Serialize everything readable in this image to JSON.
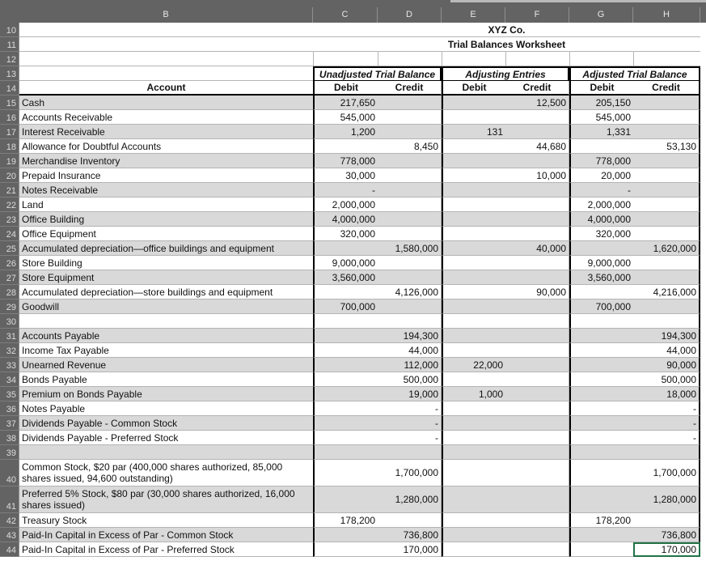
{
  "app": {
    "type": "spreadsheet",
    "accent_selection_color": "#217346",
    "header_band_color": "#636363",
    "shaded_row_color": "#d9d9d9"
  },
  "column_headers": [
    "B",
    "C",
    "D",
    "E",
    "F",
    "G",
    "H"
  ],
  "titles": {
    "company": "XYZ Co.",
    "worksheet": "Trial Balances Worksheet"
  },
  "group_headers": [
    {
      "label": "Unadjusted Trial Balance",
      "span": [
        "C",
        "D"
      ]
    },
    {
      "label": "Adjusting Entries",
      "span": [
        "E",
        "F"
      ]
    },
    {
      "label": "Adjusted Trial Balance",
      "span": [
        "G",
        "H"
      ]
    }
  ],
  "sub_headers": {
    "account": "Account",
    "unadjusted_debit": "Debit",
    "unadjusted_credit": "Credit",
    "adjusting_debit": "Debit",
    "adjusting_credit": "Credit",
    "adjusted_debit": "Debit",
    "adjusted_credit": "Credit"
  },
  "rows": [
    {
      "n": "10",
      "kind": "title",
      "text": "XYZ Co."
    },
    {
      "n": "11",
      "kind": "title",
      "text": "Trial Balances Worksheet"
    },
    {
      "n": "12",
      "kind": "blank"
    },
    {
      "n": "13",
      "kind": "group"
    },
    {
      "n": "14",
      "kind": "sub"
    },
    {
      "n": "15",
      "account": "Cash",
      "ud": "217,650",
      "uc": "",
      "ad": "",
      "ac": "12,500",
      "jd": "205,150",
      "jc": ""
    },
    {
      "n": "16",
      "account": "Accounts Receivable",
      "ud": "545,000",
      "uc": "",
      "ad": "",
      "ac": "",
      "jd": "545,000",
      "jc": ""
    },
    {
      "n": "17",
      "account": "Interest Receivable",
      "ud": "1,200",
      "uc": "",
      "ad": "131",
      "ac": "",
      "jd": "1,331",
      "jc": ""
    },
    {
      "n": "18",
      "account": "Allowance for Doubtful Accounts",
      "ud": "",
      "uc": "8,450",
      "ad": "",
      "ac": "44,680",
      "jd": "",
      "jc": "53,130"
    },
    {
      "n": "19",
      "account": "Merchandise Inventory",
      "ud": "778,000",
      "uc": "",
      "ad": "",
      "ac": "",
      "jd": "778,000",
      "jc": ""
    },
    {
      "n": "20",
      "account": "Prepaid Insurance",
      "ud": "30,000",
      "uc": "",
      "ad": "",
      "ac": "10,000",
      "jd": "20,000",
      "jc": ""
    },
    {
      "n": "21",
      "account": "Notes Receivable",
      "ud": "-",
      "uc": "",
      "ad": "",
      "ac": "",
      "jd": "-",
      "jc": ""
    },
    {
      "n": "22",
      "account": "Land",
      "ud": "2,000,000",
      "uc": "",
      "ad": "",
      "ac": "",
      "jd": "2,000,000",
      "jc": ""
    },
    {
      "n": "23",
      "account": "Office Building",
      "ud": "4,000,000",
      "uc": "",
      "ad": "",
      "ac": "",
      "jd": "4,000,000",
      "jc": ""
    },
    {
      "n": "24",
      "account": "Office Equipment",
      "ud": "320,000",
      "uc": "",
      "ad": "",
      "ac": "",
      "jd": "320,000",
      "jc": ""
    },
    {
      "n": "25",
      "account": "Accumulated depreciation—office buildings and equipment",
      "ud": "",
      "uc": "1,580,000",
      "ad": "",
      "ac": "40,000",
      "jd": "",
      "jc": "1,620,000"
    },
    {
      "n": "26",
      "account": "Store Building",
      "ud": "9,000,000",
      "uc": "",
      "ad": "",
      "ac": "",
      "jd": "9,000,000",
      "jc": ""
    },
    {
      "n": "27",
      "account": "Store Equipment",
      "ud": "3,560,000",
      "uc": "",
      "ad": "",
      "ac": "",
      "jd": "3,560,000",
      "jc": ""
    },
    {
      "n": "28",
      "account": "Accumulated depreciation—store buildings and equipment",
      "ud": "",
      "uc": "4,126,000",
      "ad": "",
      "ac": "90,000",
      "jd": "",
      "jc": "4,216,000"
    },
    {
      "n": "29",
      "account": "Goodwill",
      "ud": "700,000",
      "uc": "",
      "ad": "",
      "ac": "",
      "jd": "700,000",
      "jc": ""
    },
    {
      "n": "30",
      "account": "",
      "ud": "",
      "uc": "",
      "ad": "",
      "ac": "",
      "jd": "",
      "jc": ""
    },
    {
      "n": "31",
      "account": "Accounts Payable",
      "ud": "",
      "uc": "194,300",
      "ad": "",
      "ac": "",
      "jd": "",
      "jc": "194,300"
    },
    {
      "n": "32",
      "account": "Income Tax Payable",
      "ud": "",
      "uc": "44,000",
      "ad": "",
      "ac": "",
      "jd": "",
      "jc": "44,000"
    },
    {
      "n": "33",
      "account": "Unearned Revenue",
      "ud": "",
      "uc": "112,000",
      "ad": "22,000",
      "ac": "",
      "jd": "",
      "jc": "90,000"
    },
    {
      "n": "34",
      "account": "Bonds Payable",
      "ud": "",
      "uc": "500,000",
      "ad": "",
      "ac": "",
      "jd": "",
      "jc": "500,000"
    },
    {
      "n": "35",
      "account": "Premium on Bonds Payable",
      "ud": "",
      "uc": "19,000",
      "ad": "1,000",
      "ac": "",
      "jd": "",
      "jc": "18,000"
    },
    {
      "n": "36",
      "account": "Notes Payable",
      "ud": "",
      "uc": "-",
      "ad": "",
      "ac": "",
      "jd": "",
      "jc": "-"
    },
    {
      "n": "37",
      "account": "Dividends Payable - Common Stock",
      "ud": "",
      "uc": "-",
      "ad": "",
      "ac": "",
      "jd": "",
      "jc": "-"
    },
    {
      "n": "38",
      "account": "Dividends Payable - Preferred Stock",
      "ud": "",
      "uc": "-",
      "ad": "",
      "ac": "",
      "jd": "",
      "jc": "-"
    },
    {
      "n": "39",
      "account": "",
      "ud": "",
      "uc": "",
      "ad": "",
      "ac": "",
      "jd": "",
      "jc": ""
    },
    {
      "n": "40",
      "tall": true,
      "account": "Common Stock, $20 par (400,000 shares authorized, 85,000 shares issued, 94,600 outstanding)",
      "ud": "",
      "uc": "1,700,000",
      "ad": "",
      "ac": "",
      "jd": "",
      "jc": "1,700,000"
    },
    {
      "n": "41",
      "tall": true,
      "account": "Preferred 5% Stock, $80 par (30,000 shares authorized, 16,000 shares issued)",
      "ud": "",
      "uc": "1,280,000",
      "ad": "",
      "ac": "",
      "jd": "",
      "jc": "1,280,000"
    },
    {
      "n": "42",
      "account": "Treasury Stock",
      "ud": "178,200",
      "uc": "",
      "ad": "",
      "ac": "",
      "jd": "178,200",
      "jc": ""
    },
    {
      "n": "43",
      "account": "Paid-In Capital in Excess of Par - Common Stock",
      "ud": "",
      "uc": "736,800",
      "ad": "",
      "ac": "",
      "jd": "",
      "jc": "736,800"
    },
    {
      "n": "44",
      "account": "Paid-In Capital in Excess of Par - Preferred Stock",
      "ud": "",
      "uc": "170,000",
      "ad": "",
      "ac": "",
      "jd": "",
      "jc": "170,000"
    }
  ],
  "selection": {
    "cell": "H44"
  }
}
